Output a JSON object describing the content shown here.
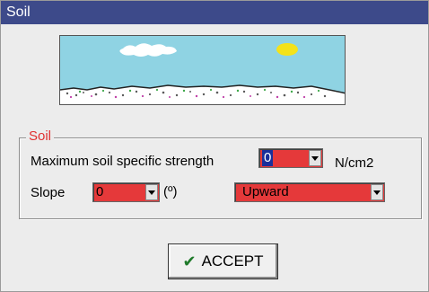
{
  "window": {
    "title": "Soil"
  },
  "soil_group": {
    "legend": "Soil",
    "max_strength_label": "Maximum soil specific strength",
    "max_strength_value": "0",
    "max_strength_unit": "N/cm2",
    "slope_label": "Slope",
    "slope_value": "0",
    "slope_unit": "(º)",
    "direction_value": "Upward"
  },
  "accept_button": {
    "label": "ACCEPT",
    "icon": "check-icon"
  },
  "colors": {
    "title_bar": "#3d4a8a",
    "combo_red": "#e5393a",
    "legend_red": "#e03030",
    "sky": "#8fd3e3",
    "sun": "#f4e21a"
  }
}
